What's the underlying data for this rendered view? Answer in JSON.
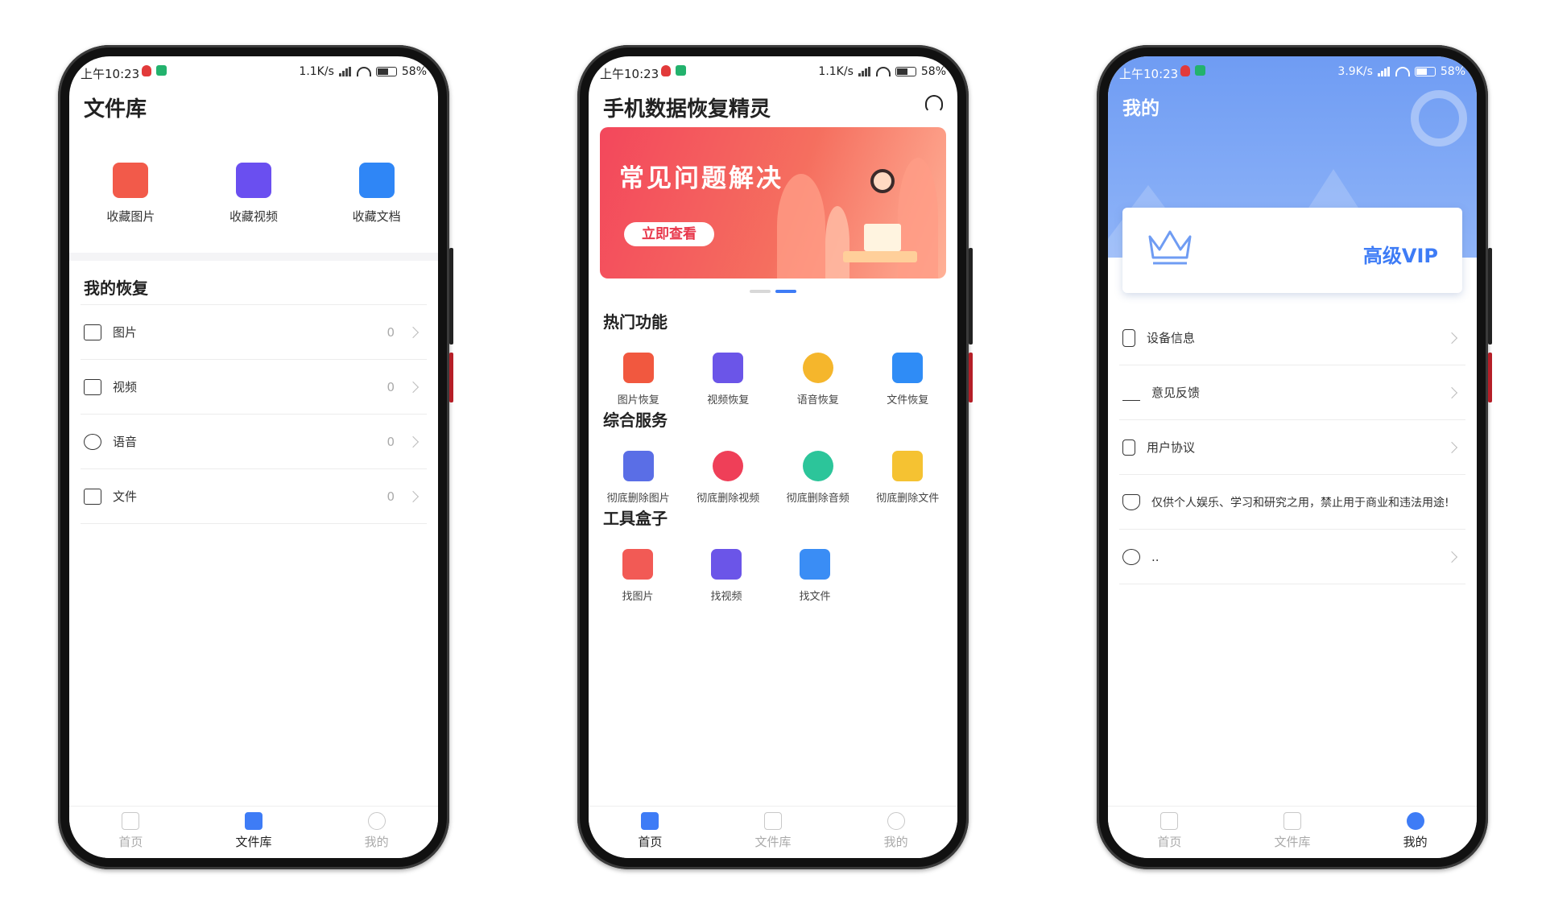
{
  "status": {
    "time": "上午10:23",
    "phone1_speed": "1.1K/s",
    "phone2_speed": "1.1K/s",
    "phone3_speed": "3.9K/s",
    "battery": "58"
  },
  "library": {
    "title": "文件库",
    "tiles": [
      {
        "label": "收藏图片",
        "icon": "image-icon",
        "color": "#f25a4a"
      },
      {
        "label": "收藏视频",
        "icon": "video-icon",
        "color": "#6a4ff0"
      },
      {
        "label": "收藏文档",
        "icon": "document-icon",
        "color": "#2f86f6"
      }
    ],
    "section_title": "我的恢复",
    "rows": [
      {
        "label": "图片",
        "count": "0"
      },
      {
        "label": "视频",
        "count": "0"
      },
      {
        "label": "语音",
        "count": "0"
      },
      {
        "label": "文件",
        "count": "0"
      }
    ]
  },
  "home": {
    "title": "手机数据恢复精灵",
    "banner_title": "常见问题解决",
    "banner_button": "立即查看",
    "section_hot": "热门功能",
    "hot": [
      {
        "label": "图片恢复",
        "color": "#f1583f"
      },
      {
        "label": "视频恢复",
        "color": "#6b55e8"
      },
      {
        "label": "语音恢复",
        "color": "#f5b62c"
      },
      {
        "label": "文件恢复",
        "color": "#2f8cf6"
      }
    ],
    "section_service": "综合服务",
    "service": [
      {
        "label": "彻底删除图片",
        "color": "#5a6ee6"
      },
      {
        "label": "彻底删除视频",
        "color": "#ef3f58"
      },
      {
        "label": "彻底删除音频",
        "color": "#2cc59a"
      },
      {
        "label": "彻底删除文件",
        "color": "#f5c232"
      }
    ],
    "section_tools": "工具盒子",
    "tools": [
      {
        "label": "找图片",
        "color": "#f25a55"
      },
      {
        "label": "找视频",
        "color": "#6b55e8"
      },
      {
        "label": "找文件",
        "color": "#3a8df5"
      }
    ]
  },
  "mine": {
    "title": "我的",
    "vip_label": "高级VIP",
    "rows": [
      {
        "label": "设备信息",
        "chevron": true
      },
      {
        "label": "意见反馈",
        "chevron": true
      },
      {
        "label": "用户协议",
        "chevron": true
      },
      {
        "label": "仅供个人娱乐、学习和研究之用，禁止用于商业和违法用途!",
        "chevron": false
      },
      {
        "label": "..",
        "chevron": true
      }
    ]
  },
  "tabs": {
    "home": "首页",
    "library": "文件库",
    "mine": "我的"
  },
  "colors": {
    "accent": "#3e7cf6",
    "banner_red": "#f3475c"
  }
}
